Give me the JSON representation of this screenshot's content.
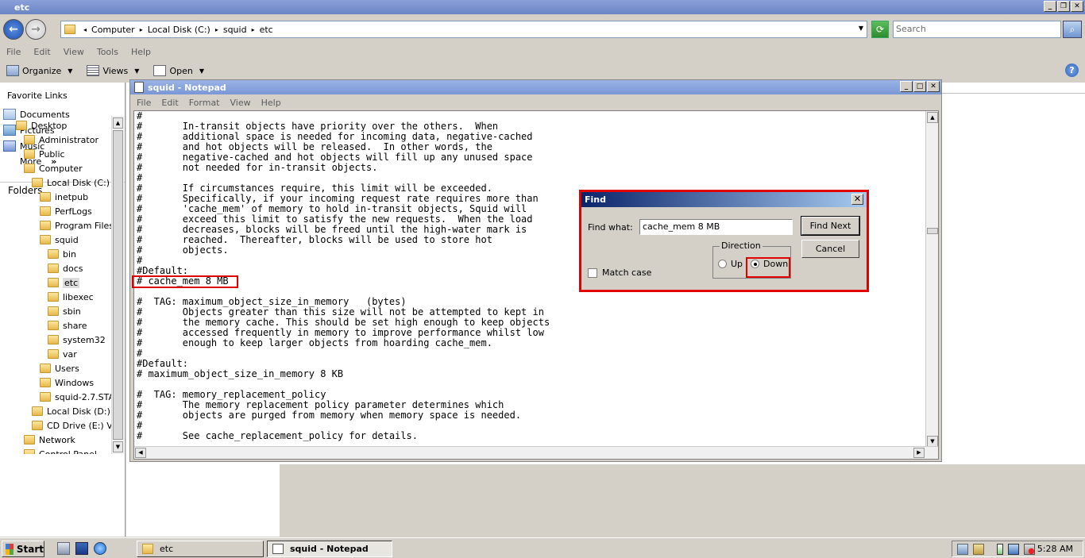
{
  "explorer": {
    "title": "etc",
    "address": {
      "crumbs": [
        "Computer",
        "Local Disk (C:)",
        "squid",
        "etc"
      ]
    },
    "search_placeholder": "Search",
    "menu": [
      "File",
      "Edit",
      "View",
      "Tools",
      "Help"
    ],
    "toolbar": {
      "organize": "Organize",
      "views": "Views",
      "open": "Open"
    }
  },
  "nav": {
    "favorites_title": "Favorite Links",
    "favorites": [
      "Documents",
      "Pictures",
      "Music"
    ],
    "more": "More",
    "more_arrows": "»",
    "folders_title": "Folders",
    "tree": [
      {
        "label": "Desktop",
        "indent": 0
      },
      {
        "label": "Administrator",
        "indent": 1
      },
      {
        "label": "Public",
        "indent": 1
      },
      {
        "label": "Computer",
        "indent": 1
      },
      {
        "label": "Local Disk (C:)",
        "indent": 2
      },
      {
        "label": "inetpub",
        "indent": 3
      },
      {
        "label": "PerfLogs",
        "indent": 3
      },
      {
        "label": "Program Files",
        "indent": 3
      },
      {
        "label": "squid",
        "indent": 3
      },
      {
        "label": "bin",
        "indent": 4
      },
      {
        "label": "docs",
        "indent": 4
      },
      {
        "label": "etc",
        "indent": 4,
        "selected": true
      },
      {
        "label": "libexec",
        "indent": 4
      },
      {
        "label": "sbin",
        "indent": 4
      },
      {
        "label": "share",
        "indent": 4
      },
      {
        "label": "system32",
        "indent": 4
      },
      {
        "label": "var",
        "indent": 4
      },
      {
        "label": "Users",
        "indent": 3
      },
      {
        "label": "Windows",
        "indent": 3
      },
      {
        "label": "squid-2.7.STA",
        "indent": 3
      },
      {
        "label": "Local Disk (D:)",
        "indent": 2
      },
      {
        "label": "CD Drive (E:) Vir",
        "indent": 2
      },
      {
        "label": "Network",
        "indent": 1
      },
      {
        "label": "Control Panel",
        "indent": 1
      }
    ]
  },
  "notepad": {
    "title": "squid - Notepad",
    "menu": [
      "File",
      "Edit",
      "Format",
      "View",
      "Help"
    ],
    "lines": [
      "#",
      "#       In-transit objects have priority over the others.  When",
      "#       additional space is needed for incoming data, negative-cached",
      "#       and hot objects will be released.  In other words, the",
      "#       negative-cached and hot objects will fill up any unused space",
      "#       not needed for in-transit objects.",
      "#",
      "#       If circumstances require, this limit will be exceeded.",
      "#       Specifically, if your incoming request rate requires more than",
      "#       'cache_mem' of memory to hold in-transit objects, Squid will",
      "#       exceed this limit to satisfy the new requests.  When the load",
      "#       decreases, blocks will be freed until the high-water mark is",
      "#       reached.  Thereafter, blocks will be used to store hot",
      "#       objects.",
      "#",
      "#Default:",
      "# cache_mem 8 MB",
      "",
      "#  TAG: maximum_object_size_in_memory   (bytes)",
      "#       Objects greater than this size will not be attempted to kept in",
      "#       the memory cache. This should be set high enough to keep objects",
      "#       accessed frequently in memory to improve performance whilst low",
      "#       enough to keep larger objects from hoarding cache_mem.",
      "#",
      "#Default:",
      "# maximum_object_size_in_memory 8 KB",
      "",
      "#  TAG: memory_replacement_policy",
      "#       The memory replacement policy parameter determines which",
      "#       objects are purged from memory when memory space is needed.",
      "#",
      "#       See cache_replacement_policy for details."
    ]
  },
  "find": {
    "title": "Find",
    "find_what_label": "Find what:",
    "find_what_value": "cache_mem 8 MB",
    "find_next": "Find Next",
    "cancel": "Cancel",
    "direction_label": "Direction",
    "up": "Up",
    "down": "Down",
    "match_case": "Match case"
  },
  "taskbar": {
    "start": "Start",
    "tasks": [
      "etc",
      "squid - Notepad"
    ],
    "clock": "5:28 AM"
  }
}
